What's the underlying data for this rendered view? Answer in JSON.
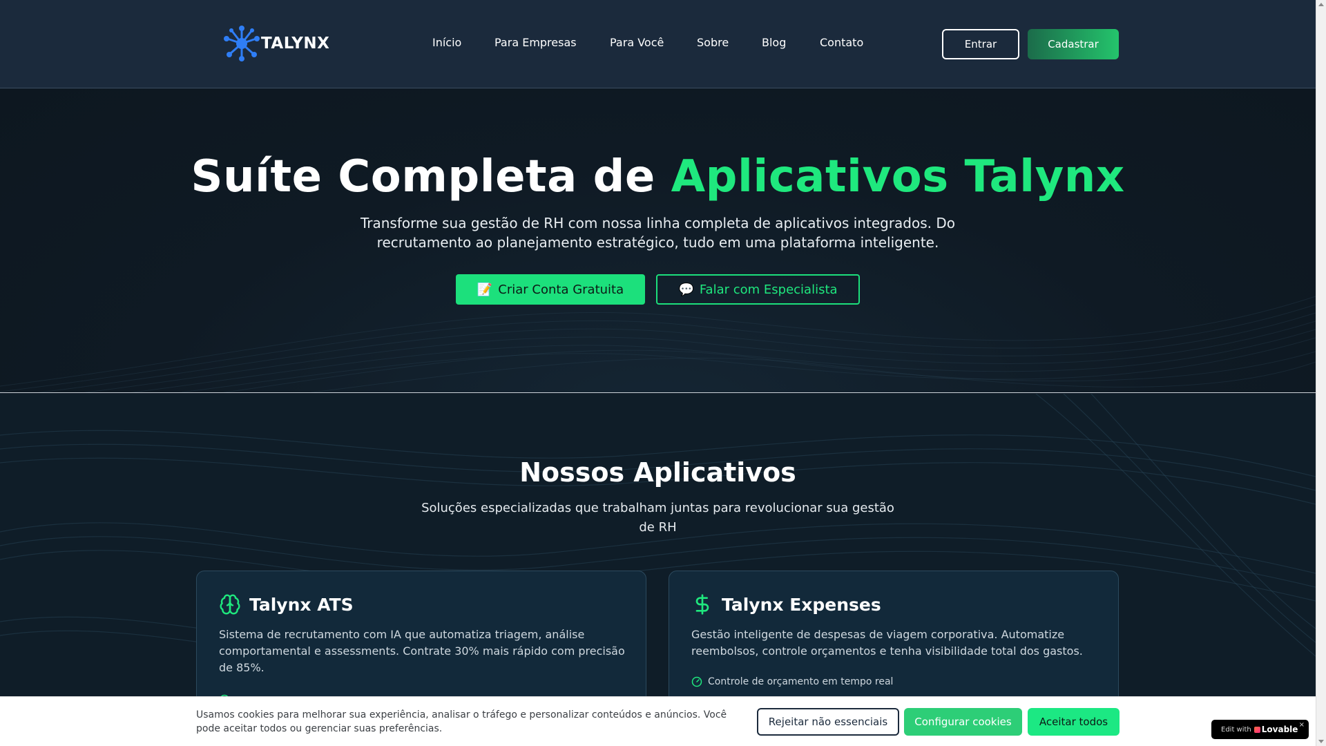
{
  "brand": {
    "name": "TALYNX"
  },
  "nav": {
    "items": [
      {
        "label": "Início"
      },
      {
        "label": "Para Empresas"
      },
      {
        "label": "Para Você"
      },
      {
        "label": "Sobre"
      },
      {
        "label": "Blog"
      },
      {
        "label": "Contato"
      }
    ],
    "login_label": "Entrar",
    "signup_label": "Cadastrar"
  },
  "hero": {
    "title_plain": "Suíte Completa de ",
    "title_accent": "Aplicativos Talynx",
    "subtitle": "Transforme sua gestão de RH com nossa linha completa de aplicativos integrados. Do recrutamento ao planejamento estratégico, tudo em uma plataforma inteligente.",
    "primary_cta": "Criar Conta Gratuita",
    "primary_cta_icon": "📝",
    "secondary_cta": "Falar com Especialista",
    "secondary_cta_icon": "💬"
  },
  "apps": {
    "title": "Nossos Aplicativos",
    "subtitle": "Soluções especializadas que trabalham juntas para revolucionar sua gestão de RH",
    "cards": [
      {
        "title": "Talynx ATS",
        "icon": "brain-icon",
        "description": "Sistema de recrutamento com IA que automatiza triagem, análise comportamental e assessments. Contrate 30% mais rápido com precisão de 85%."
      },
      {
        "title": "Talynx Expenses",
        "icon": "dollar-icon",
        "description": "Gestão inteligente de despesas de viagem corporativa. Automatize reembolsos, controle orçamentos e tenha visibilidade total dos gastos.",
        "features": [
          "Controle de orçamento em tempo real"
        ]
      }
    ]
  },
  "cookie": {
    "text": "Usamos cookies para melhorar sua experiência, analisar o tráfego e personalizar conteúdos e anúncios. Você pode aceitar todos ou gerenciar suas preferências.",
    "reject_label": "Rejeitar não essenciais",
    "configure_label": "Configurar cookies",
    "accept_label": "Aceitar todos"
  },
  "badge": {
    "edit_label": "Edit with",
    "brand_label": "Lovable",
    "close_label": "×"
  },
  "colors": {
    "accent": "#1fe87e",
    "header_bg": "#1b2a3c",
    "hero_bg": "#0f1a24",
    "card_bg": "#12293a"
  }
}
